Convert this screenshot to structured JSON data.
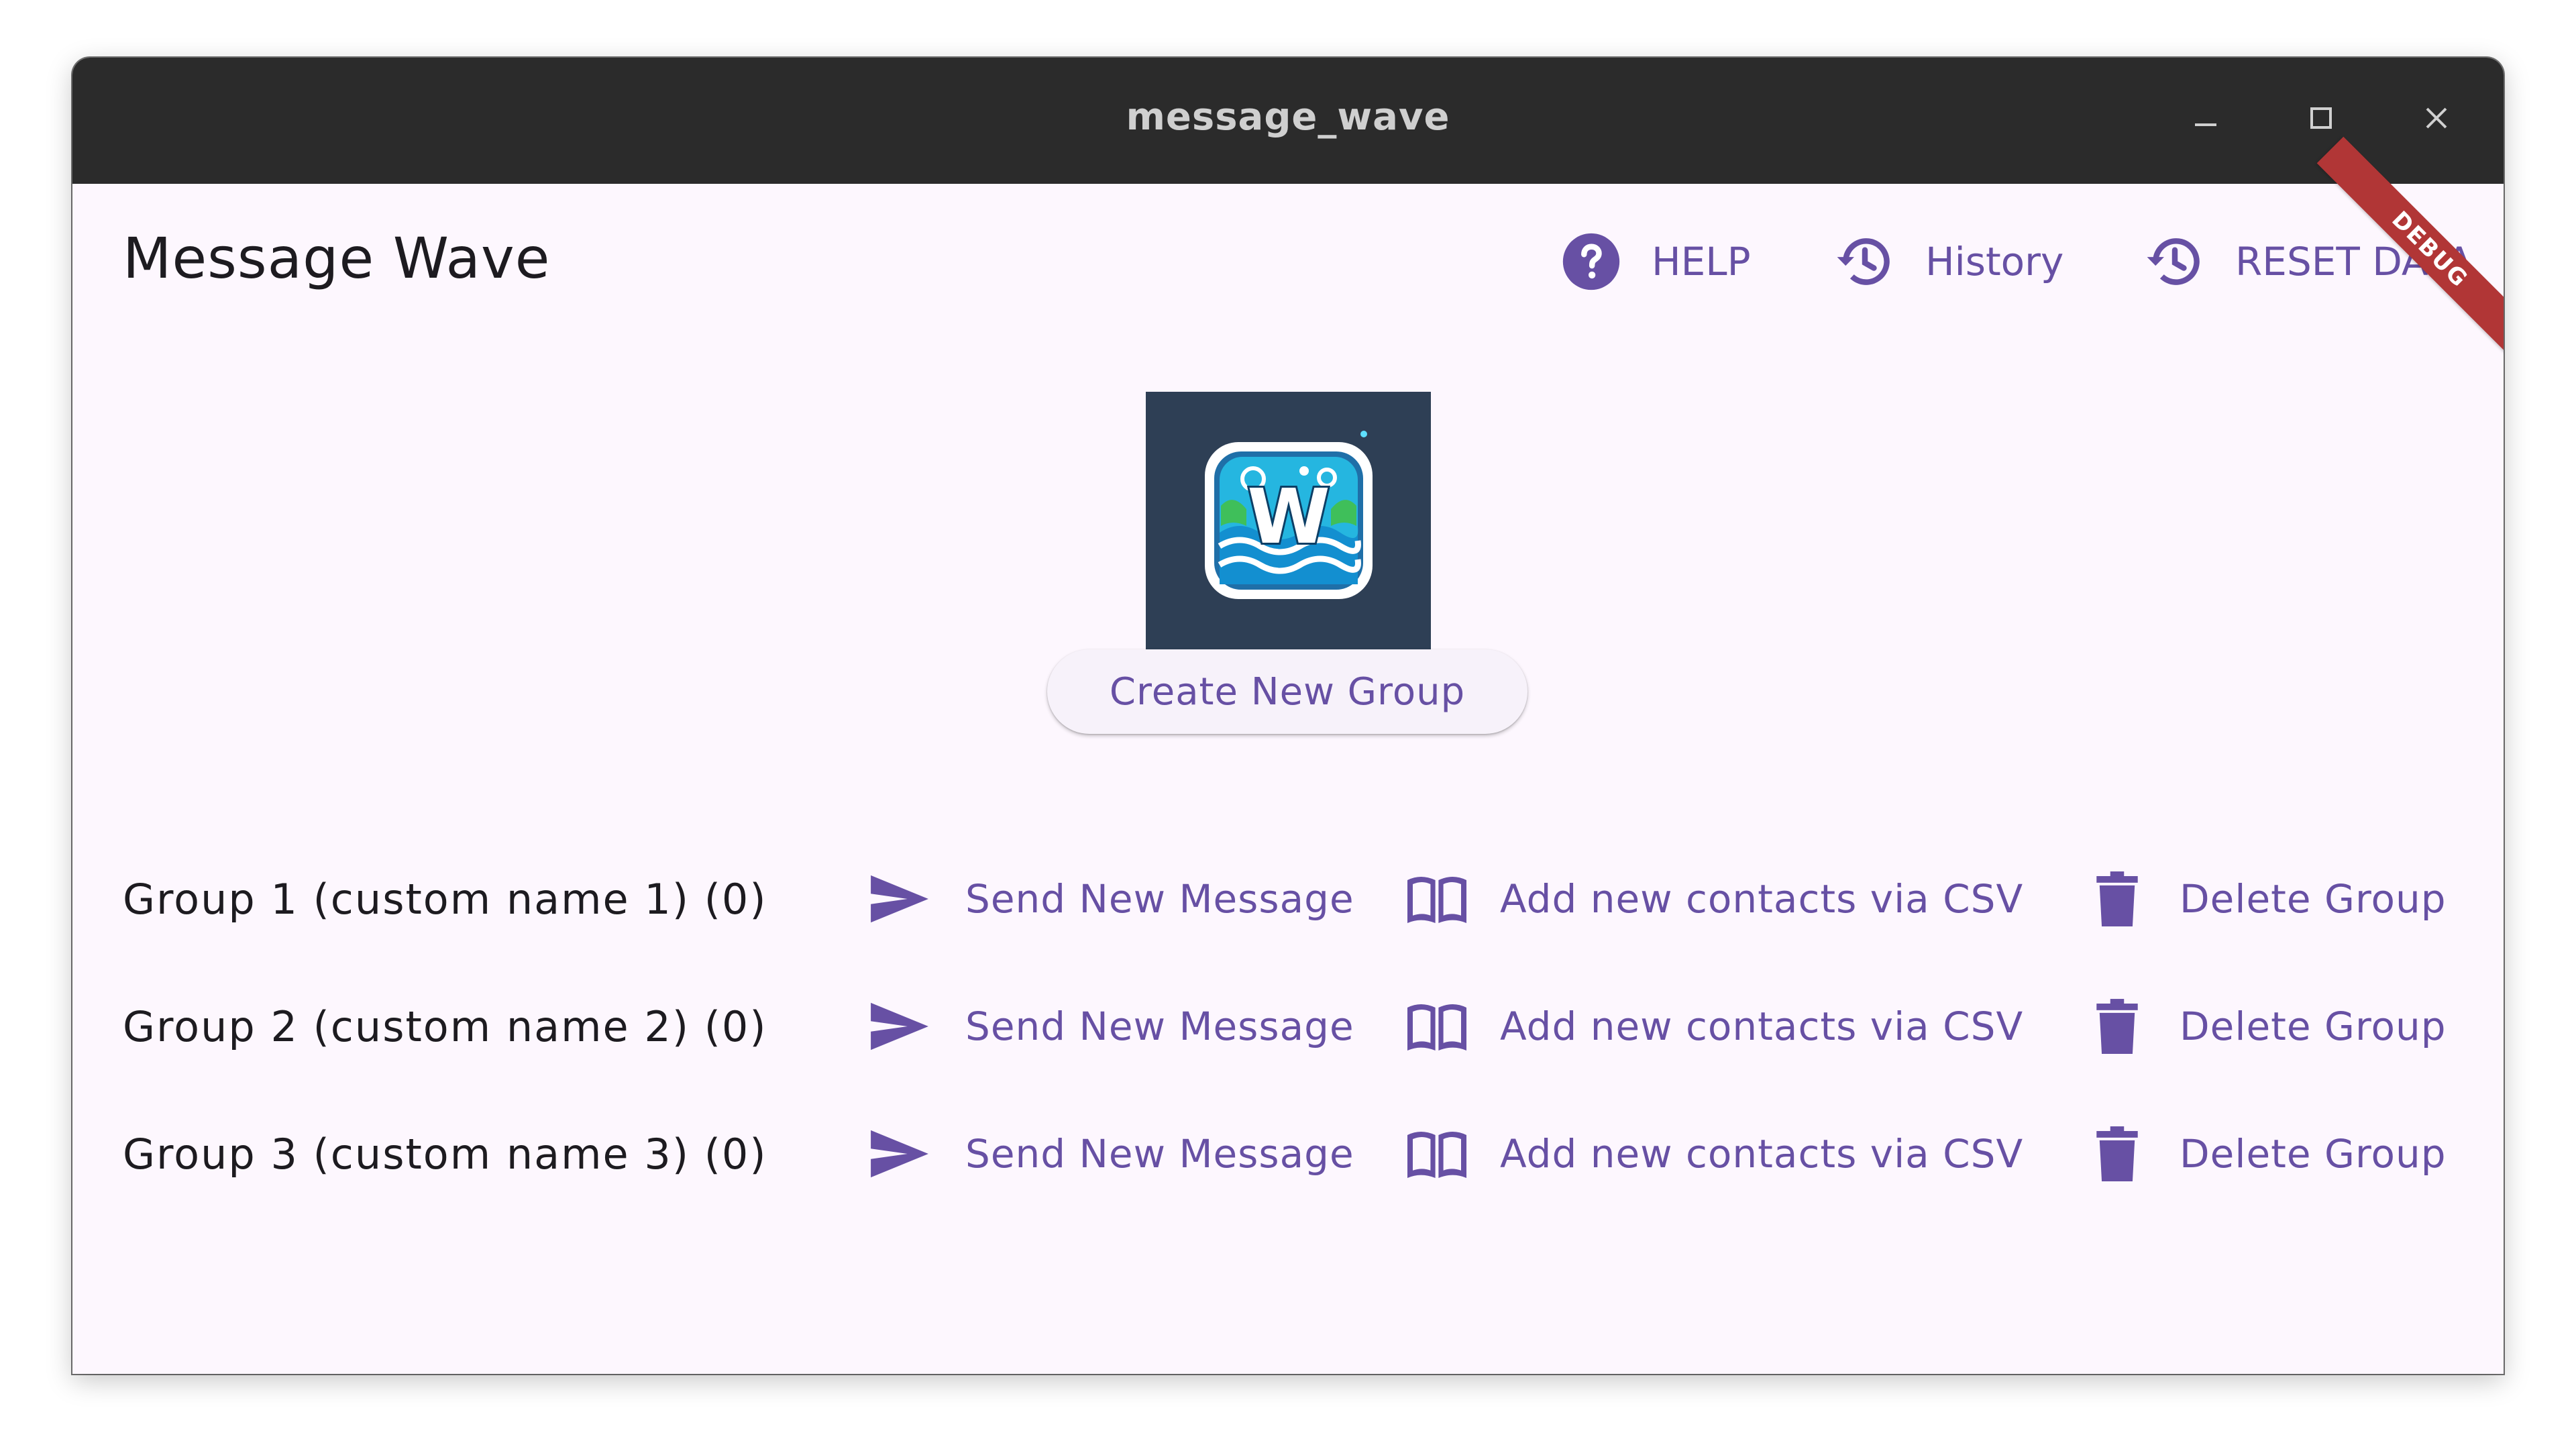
{
  "window": {
    "title": "message_wave",
    "controls": {
      "minimize": "minimize-icon",
      "maximize": "maximize-icon",
      "close": "close-icon"
    }
  },
  "app": {
    "title": "Message Wave",
    "accent_color": "#6750a4",
    "debug_label": "DEBUG"
  },
  "toolbar": {
    "help_label": "HELP",
    "history_label": "History",
    "reset_label": "RESET DATA"
  },
  "main": {
    "logo_letter": "W",
    "create_group_label": "Create New Group",
    "groups": [
      {
        "label": "Group 1 (custom name 1) (0)",
        "send_label": "Send New Message",
        "csv_label": "Add new contacts via CSV",
        "delete_label": "Delete Group"
      },
      {
        "label": "Group 2 (custom name 2) (0)",
        "send_label": "Send New Message",
        "csv_label": "Add new contacts via CSV",
        "delete_label": "Delete Group"
      },
      {
        "label": "Group 3 (custom name 3) (0)",
        "send_label": "Send New Message",
        "csv_label": "Add new contacts via CSV",
        "delete_label": "Delete Group"
      }
    ]
  }
}
